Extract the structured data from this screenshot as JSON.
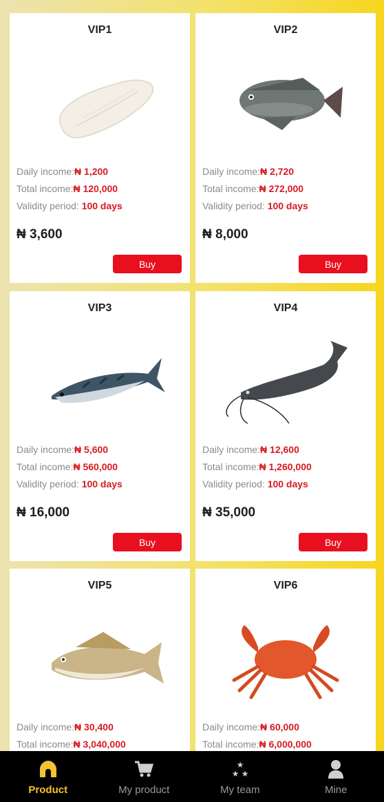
{
  "currency": "₦",
  "cards": [
    {
      "title": "VIP1",
      "image": "fish-fillet",
      "daily_label": "Daily income:",
      "daily": "₦ 1,200",
      "total_label": "Total income:",
      "total": "₦ 120,000",
      "validity_label": "Validity period: ",
      "validity": "100 days",
      "price": "₦ 3,600",
      "buy": "Buy"
    },
    {
      "title": "VIP2",
      "image": "tilapia",
      "daily_label": "Daily income:",
      "daily": "₦ 2,720",
      "total_label": "Total income:",
      "total": "₦ 272,000",
      "validity_label": "Validity period: ",
      "validity": "100 days",
      "price": "₦ 8,000",
      "buy": "Buy"
    },
    {
      "title": "VIP3",
      "image": "mackerel",
      "daily_label": "Daily income:",
      "daily": "₦ 5,600",
      "total_label": "Total income:",
      "total": "₦ 560,000",
      "validity_label": "Validity period: ",
      "validity": "100 days",
      "price": "₦ 16,000",
      "buy": "Buy"
    },
    {
      "title": "VIP4",
      "image": "catfish",
      "daily_label": "Daily income:",
      "daily": "₦ 12,600",
      "total_label": "Total income:",
      "total": "₦ 1,260,000",
      "validity_label": "Validity period: ",
      "validity": "100 days",
      "price": "₦ 35,000",
      "buy": "Buy"
    },
    {
      "title": "VIP5",
      "image": "croaker",
      "daily_label": "Daily income:",
      "daily": "₦ 30,400",
      "total_label": "Total income:",
      "total": "₦ 3,040,000",
      "validity_label": "",
      "validity": "",
      "price": "",
      "buy": ""
    },
    {
      "title": "VIP6",
      "image": "crab",
      "daily_label": "Daily income:",
      "daily": "₦ 60,000",
      "total_label": "Total income:",
      "total": "₦ 6,000,000",
      "validity_label": "",
      "validity": "",
      "price": "",
      "buy": ""
    }
  ],
  "nav": [
    {
      "label": "Product",
      "icon": "home-icon",
      "active": true
    },
    {
      "label": "My product",
      "icon": "cart-icon",
      "active": false
    },
    {
      "label": "My team",
      "icon": "stars-icon",
      "active": false
    },
    {
      "label": "Mine",
      "icon": "person-icon",
      "active": false
    }
  ],
  "colors": {
    "accent": "#e8101f",
    "value_red": "#d71a21",
    "nav_active": "#f4c430",
    "nav_bg": "#000000"
  }
}
